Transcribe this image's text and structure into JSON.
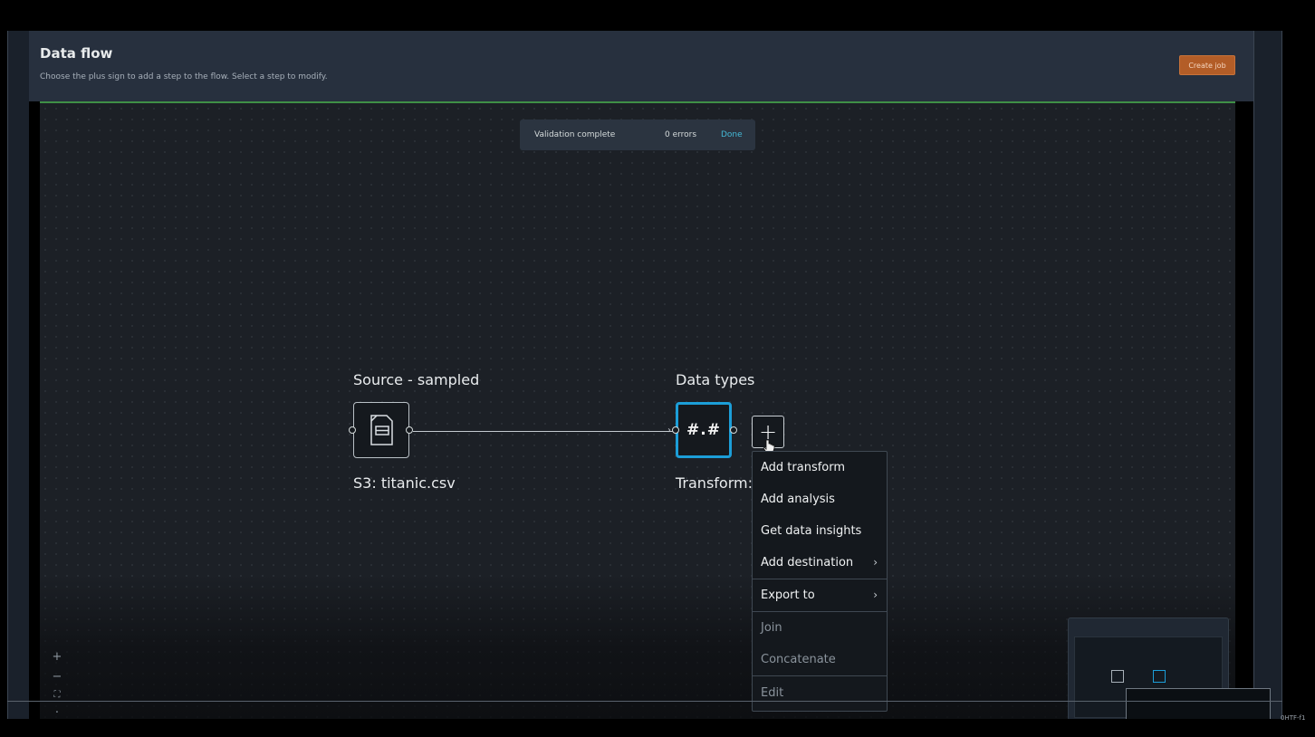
{
  "header": {
    "title": "Data flow",
    "subtitle": "Choose the plus sign to add a step to the flow. Select a step to modify.",
    "create_job_label": "Create job"
  },
  "validation": {
    "status_text": "Validation complete",
    "errors_text": "0 errors",
    "done_label": "Done"
  },
  "nodes": {
    "source": {
      "title": "Source - sampled",
      "subtitle": "S3: titanic.csv",
      "icon": "document-table-icon"
    },
    "types": {
      "title": "Data types",
      "subtitle": "Transform:",
      "glyph": "#.#"
    }
  },
  "add_step": {
    "label": "+"
  },
  "context_menu": {
    "items": [
      {
        "label": "Add transform",
        "enabled": true,
        "submenu": false
      },
      {
        "label": "Add analysis",
        "enabled": true,
        "submenu": false
      },
      {
        "label": "Get data insights",
        "enabled": true,
        "submenu": false
      },
      {
        "label": "Add destination",
        "enabled": true,
        "submenu": true
      },
      {
        "label": "Export to",
        "enabled": true,
        "submenu": true
      },
      {
        "label": "Join",
        "enabled": false,
        "submenu": false
      },
      {
        "label": "Concatenate",
        "enabled": false,
        "submenu": false
      },
      {
        "label": "Edit",
        "enabled": false,
        "submenu": false
      }
    ],
    "chevron": "›"
  },
  "zoom": {
    "zoom_in": "+",
    "zoom_out": "−",
    "fit": "⛶",
    "more": "·"
  },
  "footer": {
    "code": "0HTF-f1"
  },
  "colors": {
    "accent": "#1c9ed8",
    "create_job": "#b35d27",
    "divider_green": "#3f8f46",
    "link": "#44b9d6"
  }
}
